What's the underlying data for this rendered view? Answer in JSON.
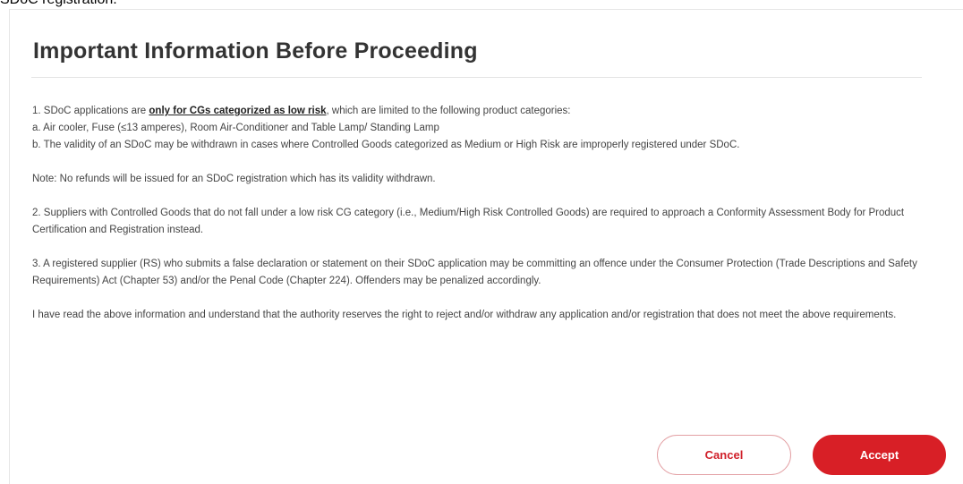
{
  "caption": "SDoC registration.",
  "modal": {
    "title": "Important Information Before Proceeding",
    "item1": {
      "prefix": "1. SDoC applications are ",
      "emphasis": "only for CGs categorized as low risk",
      "suffix": ", which are limited to the following product categories:"
    },
    "item1_a": "a. Air cooler, Fuse (≤13 amperes), Room Air-Conditioner and Table Lamp/ Standing Lamp",
    "item1_b": "b. The validity of an SDoC may be withdrawn in cases where Controlled Goods categorized as Medium or High Risk are improperly registered under SDoC.",
    "note": "Note: No refunds will be issued for an SDoC registration which has its validity withdrawn.",
    "item2": "2. Suppliers with Controlled Goods that do not fall under a low risk CG category (i.e., Medium/High Risk Controlled Goods) are required to approach a Conformity Assessment Body for Product Certification and Registration instead.",
    "item3": "3. A registered supplier (RS) who submits a false declaration or statement on their SDoC application may be committing an offence under the Consumer Protection (Trade Descriptions and Safety Requirements) Act (Chapter 53) and/or the Penal Code (Chapter 224). Offenders may be penalized accordingly.",
    "acknowledgement": "I have read the above information and understand that the authority reserves the right to reject and/or withdraw any application and/or registration that does not meet the above requirements.",
    "cancel_label": "Cancel",
    "accept_label": "Accept"
  },
  "colors": {
    "accent": "#d81f26",
    "title": "#333333",
    "body": "#444444"
  }
}
